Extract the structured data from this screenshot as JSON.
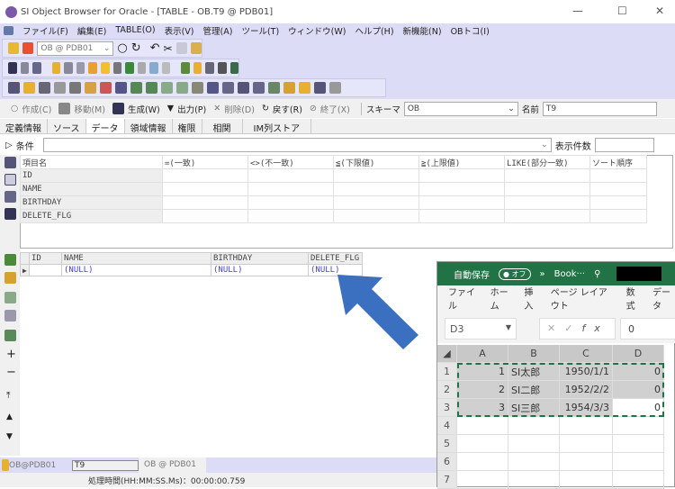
{
  "window": {
    "title": "SI Object Browser for Oracle - [TABLE - OB.T9 @ PDB01]"
  },
  "menu": [
    "ファイル(F)",
    "編集(E)",
    "TABLE(O)",
    "表示(V)",
    "管理(A)",
    "ツール(T)",
    "ウィンドウ(W)",
    "ヘルプ(H)",
    "新機能(N)",
    "OBトコ(I)"
  ],
  "toolbar": {
    "connection": "OB @ PDB01"
  },
  "actions": {
    "create": "作成(C)",
    "move": "移動(M)",
    "generate": "生成(W)",
    "output": "出力(P)",
    "delete": "削除(D)",
    "revert": "戻す(R)",
    "finish": "終了(X)",
    "schema_label": "スキーマ",
    "schema": "OB",
    "name_label": "名前",
    "name": "T9"
  },
  "tabs": [
    "定義情報",
    "ソース",
    "データ",
    "領域情報",
    "権限",
    "相関",
    "IM列ストア"
  ],
  "condition": {
    "label": "条件",
    "value": "",
    "count_label": "表示件数",
    "count": ""
  },
  "criteria": {
    "headers": [
      "項目名",
      "=(一致)",
      "<>(不一致)",
      "≦(下限値)",
      "≧(上限値)",
      "LIKE(部分一致)",
      "ソート順序"
    ],
    "rows": [
      "ID",
      "NAME",
      "BIRTHDAY",
      "DELETE_FLG"
    ]
  },
  "data_grid": {
    "headers": [
      "ID",
      "NAME",
      "BIRTHDAY",
      "DELETE_FLG"
    ],
    "rows": [
      [
        "",
        "(NULL)",
        "(NULL)",
        "(NULL)"
      ]
    ]
  },
  "bottom_tabs": [
    "OB@PDB01",
    "T9",
    "OB @ PDB01"
  ],
  "status": "処理時間(HH:MM:SS.Ms)：00:00:00.759",
  "excel": {
    "autosave": "自動保存",
    "toggle": "オフ",
    "book": "Book···",
    "ribbon": [
      "ファイル",
      "ホーム",
      "挿入",
      "ページ レイアウト",
      "数式",
      "データ"
    ],
    "namebox": "D3",
    "formula": "0",
    "columns": [
      "A",
      "B",
      "C",
      "D"
    ],
    "row_numbers": [
      "1",
      "2",
      "3",
      "4",
      "5",
      "6",
      "7"
    ],
    "rows": [
      [
        "1",
        "SI太郎",
        "1950/1/1",
        "0"
      ],
      [
        "2",
        "SI二郎",
        "1952/2/2",
        "0"
      ],
      [
        "3",
        "SI三郎",
        "1954/3/3",
        "0"
      ]
    ]
  },
  "colors": {
    "accent": "#dcdcf6",
    "excel_green": "#217346",
    "arrow": "#3b6fc0"
  }
}
